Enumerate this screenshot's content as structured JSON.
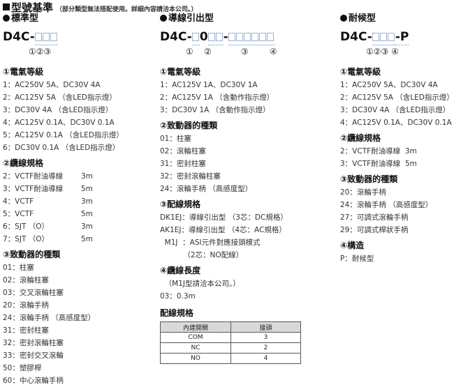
{
  "page_title": "型號基準",
  "page_note": "（部分類型無法搭配使用。詳細內容請洽本公司。）",
  "columns": [
    {
      "type_name": "標準型",
      "model_prefix": "D4C-",
      "markers": "①②③",
      "sections": [
        {
          "heading": "①電氣等級",
          "items": [
            "1：AC250V 5A、DC30V 4A",
            "2：AC125V 5A （含LED指示燈）",
            "3：DC30V 4A （含LED指示燈）",
            "4：AC125V 0.1A、DC30V 0.1A",
            "5：AC125V 0.1A （含LED指示燈）",
            "6：DC30V 0.1A （含LED指示燈）"
          ]
        },
        {
          "heading": "②纜線規格",
          "items": [
            {
              "label": "2：VCTF耐油導線",
              "length": "3m"
            },
            {
              "label": "3：VCTF耐油導線",
              "length": "5m"
            },
            {
              "label": "4：VCTF",
              "length": "3m"
            },
            {
              "label": "5：VCTF",
              "length": "5m"
            },
            {
              "label": "6：SJT （O）",
              "length": "3m"
            },
            {
              "label": "7：SJT （O）",
              "length": "5m"
            }
          ]
        },
        {
          "heading": "③致動器的種類",
          "items": [
            "01：柱塞",
            "02：滾輪柱塞",
            "03：交叉滾輪柱塞",
            "20：滾輪手柄",
            "24：滾輪手柄 （高感度型）",
            "31：密封柱塞",
            "32：密封滾輪柱塞",
            "33：密封交叉滾輪",
            "50：塑膠桿",
            "60：中心滾輪手柄"
          ]
        }
      ]
    },
    {
      "type_name": "導線引出型",
      "model_prefix": "D4C-",
      "model_mid": "0",
      "model_dash": "-",
      "markers": "①    ②           ③        ④",
      "sections": [
        {
          "heading": "①電氣等級",
          "items": [
            "1：AC125V 1A、DC30V 1A",
            "2：AC125V 1A （含動作指示燈）",
            "3：DC30V 1A （含動作指示燈）"
          ]
        },
        {
          "heading": "②致動器的種類",
          "items": [
            "01：柱塞",
            "02：滾輪柱塞",
            "31：密封柱塞",
            "32：密封滾輪柱塞",
            "24：滾輪手柄 （高感度型）"
          ]
        },
        {
          "heading": "③配線規格",
          "items": [
            "DK1EJ：導線引出型 （3芯：DC規格）",
            "AK1EJ：導線引出型 （4芯：AC規格）",
            "  M1J  ：ASI元件對應接頭模式",
            "          （2芯：NO配線）"
          ]
        },
        {
          "heading": "④纜線長度",
          "items": [
            "  （M1J型請洽本公司。）",
            "03：0.3m"
          ]
        }
      ],
      "wiring_table": {
        "title": "配線規格",
        "headers": [
          "內建開關",
          "接頭"
        ],
        "rows": [
          [
            "COM",
            "3"
          ],
          [
            "NC",
            "2"
          ],
          [
            "NO",
            "4"
          ]
        ]
      }
    },
    {
      "type_name": "耐候型",
      "model_prefix": "D4C-",
      "model_suffix": "-P",
      "markers": "①②③ ④",
      "sections": [
        {
          "heading": "①電氣等級",
          "items": [
            "1：AC250V 5A、DC30V 4A",
            "2：AC125V 5A （含LED指示燈）",
            "3：DC30V 4A （含LED指示燈）",
            "4：AC125V 0.1A、DC30V 0.1A"
          ]
        },
        {
          "heading": "②纜線規格",
          "items": [
            "2：VCTF耐油導線  3m",
            "3：VCTF耐油導線  5m"
          ]
        },
        {
          "heading": "③致動器的種類",
          "items": [
            "20：滾輪手柄",
            "24：滾輪手柄 （高感度型）",
            "27：可調式滾輪手柄",
            "29：可調式桿狀手柄"
          ]
        },
        {
          "heading": "④構造",
          "items": [
            "P：耐候型"
          ]
        }
      ]
    }
  ]
}
